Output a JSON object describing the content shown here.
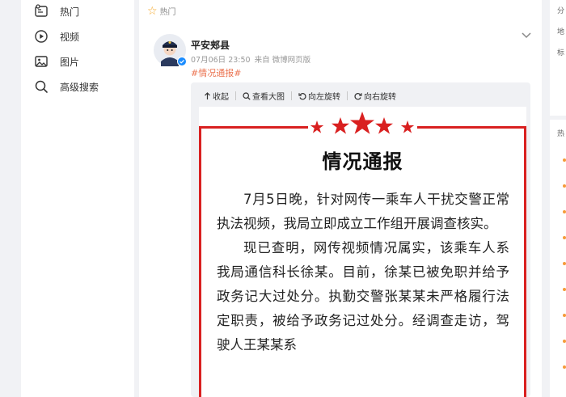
{
  "sidebar": {
    "items": [
      {
        "label": "热门",
        "icon": "hot-icon"
      },
      {
        "label": "视频",
        "icon": "video-icon"
      },
      {
        "label": "图片",
        "icon": "image-icon"
      },
      {
        "label": "高级搜索",
        "icon": "search-icon"
      }
    ]
  },
  "feed": {
    "section_label": "热门",
    "post": {
      "author": "平安郏县",
      "time": "07月06日 23:50",
      "source": "来自 微博网页版",
      "hashtag": "#情况通报#",
      "toolbar": {
        "collapse": "收起",
        "view_large": "查看大图",
        "rotate_left": "向左旋转",
        "rotate_right": "向右旋转"
      },
      "image": {
        "title": "情况通报",
        "paragraphs": [
          "7月5日晚，针对网传一乘车人干扰交警正常执法视频，我局立即成立工作组开展调查核实。",
          "现已查明，网传视频情况属实，该乘车人系我局通信科长徐某。目前，徐某已被免职并给予政务记大过处分。执勤交警张某某未严格履行法定职责，被给予政务记过处分。经调查走访，驾驶人王某某系"
        ]
      }
    }
  },
  "right_sidebar": {
    "panel1_labels": [
      "分",
      "地",
      "标"
    ],
    "panel2_label": "热"
  },
  "colors": {
    "accent_orange": "#eb7350",
    "star_yellow": "#f5a623",
    "doc_red": "#d92020"
  }
}
